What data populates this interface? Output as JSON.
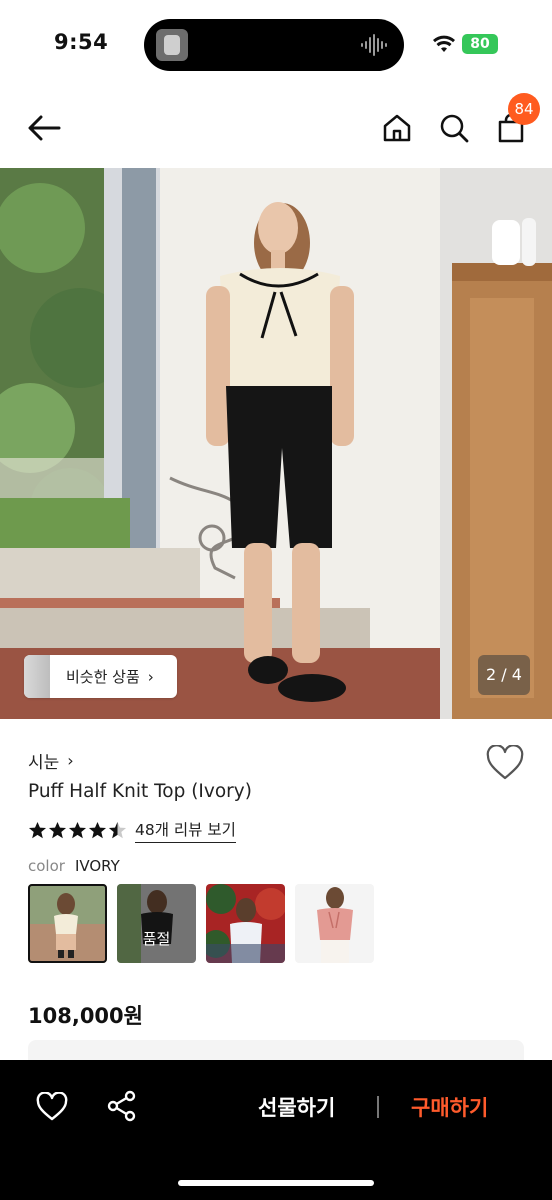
{
  "status": {
    "time": "9:54",
    "battery": "80"
  },
  "nav": {
    "cart_count": "84"
  },
  "image": {
    "similar_label": "비슷한 상품",
    "counter": "2 / 4"
  },
  "product": {
    "brand": "시눈",
    "name": "Puff Half Knit Top (Ivory)",
    "rating": 4.5,
    "review_link": "48개 리뷰 보기",
    "color_label": "color",
    "color_value": "IVORY",
    "soldout_label": "품절",
    "price": "108,000원"
  },
  "bottom": {
    "gift_label": "선물하기",
    "buy_label": "구매하기"
  },
  "colors": {
    "accent": "#ff5b1f",
    "buy": "#ff5b2c",
    "battery": "#35c759"
  }
}
